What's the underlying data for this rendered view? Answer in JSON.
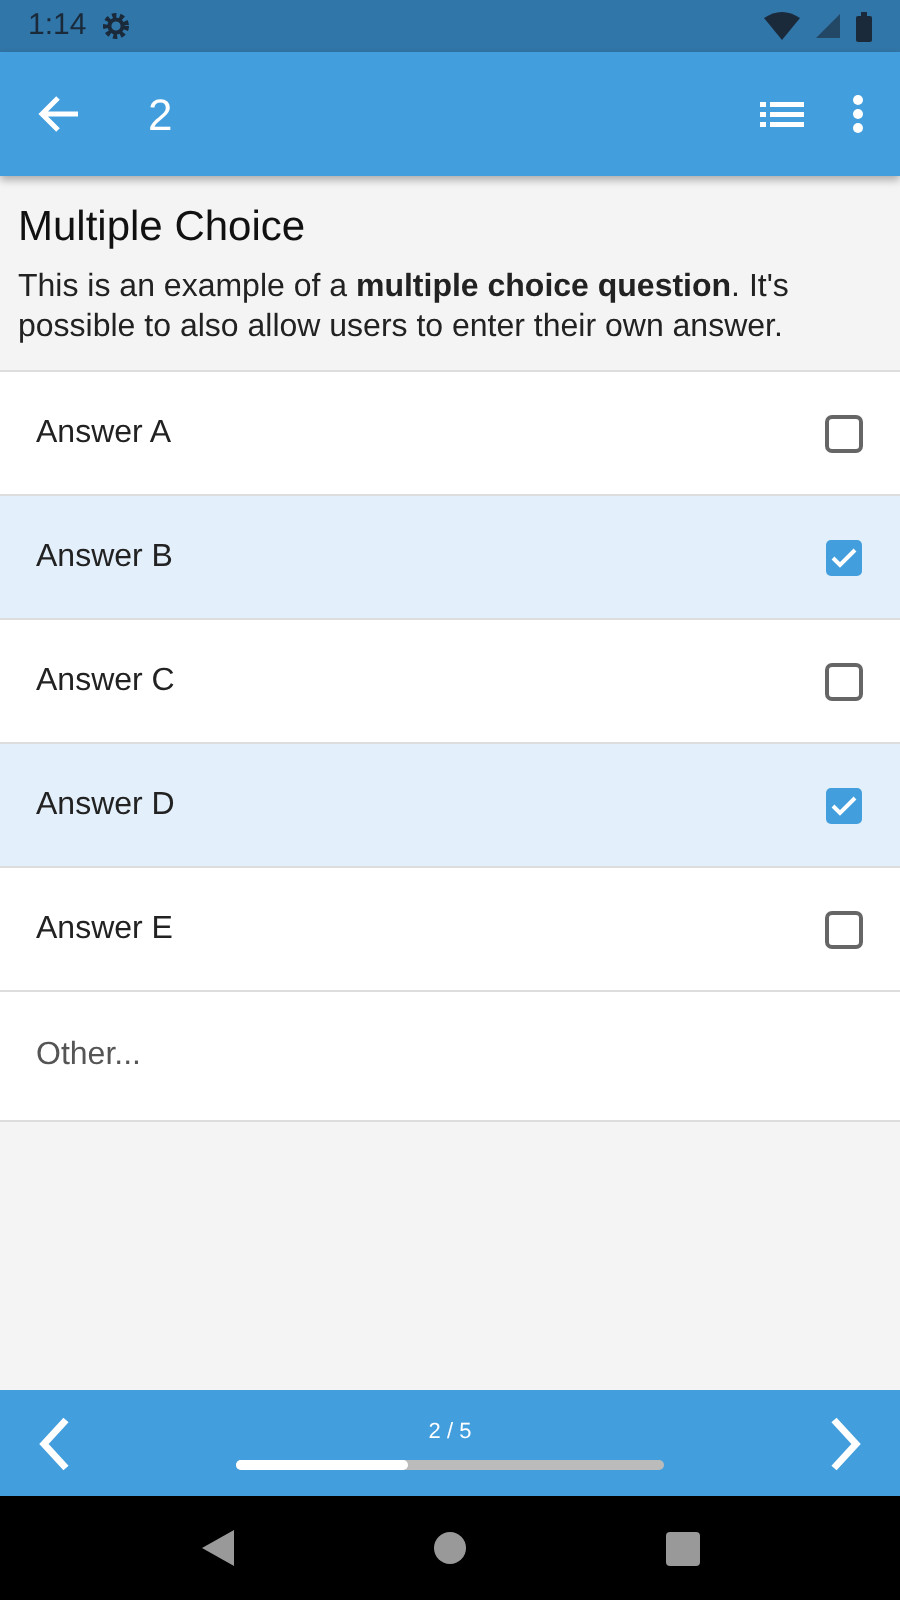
{
  "status_bar": {
    "time": "1:14"
  },
  "app_bar": {
    "title": "2"
  },
  "question": {
    "title": "Multiple Choice",
    "description": "This is an example of a **multiple choice question**. It's possible to also allow users to enter their own answer."
  },
  "answers": [
    {
      "label": "Answer A",
      "checked": false
    },
    {
      "label": "Answer B",
      "checked": true
    },
    {
      "label": "Answer C",
      "checked": false
    },
    {
      "label": "Answer D",
      "checked": true
    },
    {
      "label": "Answer E",
      "checked": false
    }
  ],
  "other": {
    "placeholder": "Other..."
  },
  "pager": {
    "position": "2 / 5",
    "level": 0.4
  }
}
